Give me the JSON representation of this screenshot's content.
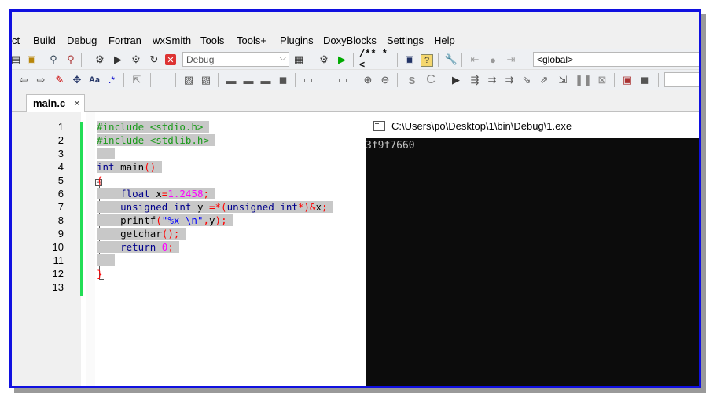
{
  "menu": [
    "ct",
    "Build",
    "Debug",
    "Fortran",
    "wxSmith",
    "Tools",
    "Tools+",
    "Plugins",
    "DoxyBlocks",
    "Settings",
    "Help"
  ],
  "toolbar": {
    "build_target": "Debug",
    "doxy_comment": "/** *<",
    "scope": "<global>"
  },
  "editor": {
    "tab_label": "main.c",
    "tab_close": "×",
    "line_numbers": [
      "1",
      "2",
      "3",
      "4",
      "5",
      "6",
      "7",
      "8",
      "9",
      "10",
      "11",
      "12",
      "13"
    ]
  },
  "console": {
    "title": "C:\\Users\\po\\Desktop\\1\\bin\\Debug\\1.exe",
    "output": "3f9f7660"
  },
  "colors": {
    "frame_border": "#1010e0",
    "change_bar": "#22dd55",
    "selection": "#c8c8c8",
    "console_bg": "#0c0c0c"
  }
}
